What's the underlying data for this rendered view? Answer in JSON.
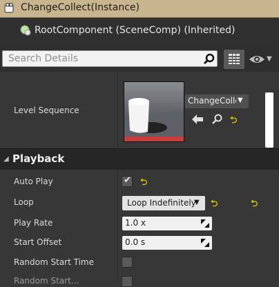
{
  "header": {
    "title": "ChangeCollect(Instance)"
  },
  "root_component": {
    "label": "RootComponent (SceneComp) (Inherited)"
  },
  "search": {
    "placeholder": "Search Details"
  },
  "level_sequence": {
    "label": "Level Sequence",
    "asset_name": "ChangeCollec"
  },
  "playback": {
    "title": "Playback",
    "auto_play": {
      "label": "Auto Play",
      "checked": true
    },
    "loop": {
      "label": "Loop",
      "value": "Loop Indefinitely"
    },
    "play_rate": {
      "label": "Play Rate",
      "value": "1.0 x"
    },
    "start_offset": {
      "label": "Start Offset",
      "value": "0.0 s"
    },
    "random_start_time": {
      "label": "Random Start Time",
      "checked": false
    },
    "partial_row": {
      "label": "Random Start..."
    }
  },
  "colors": {
    "header_bg": "#c8b48d",
    "reset_arrow": "#d9c100"
  }
}
